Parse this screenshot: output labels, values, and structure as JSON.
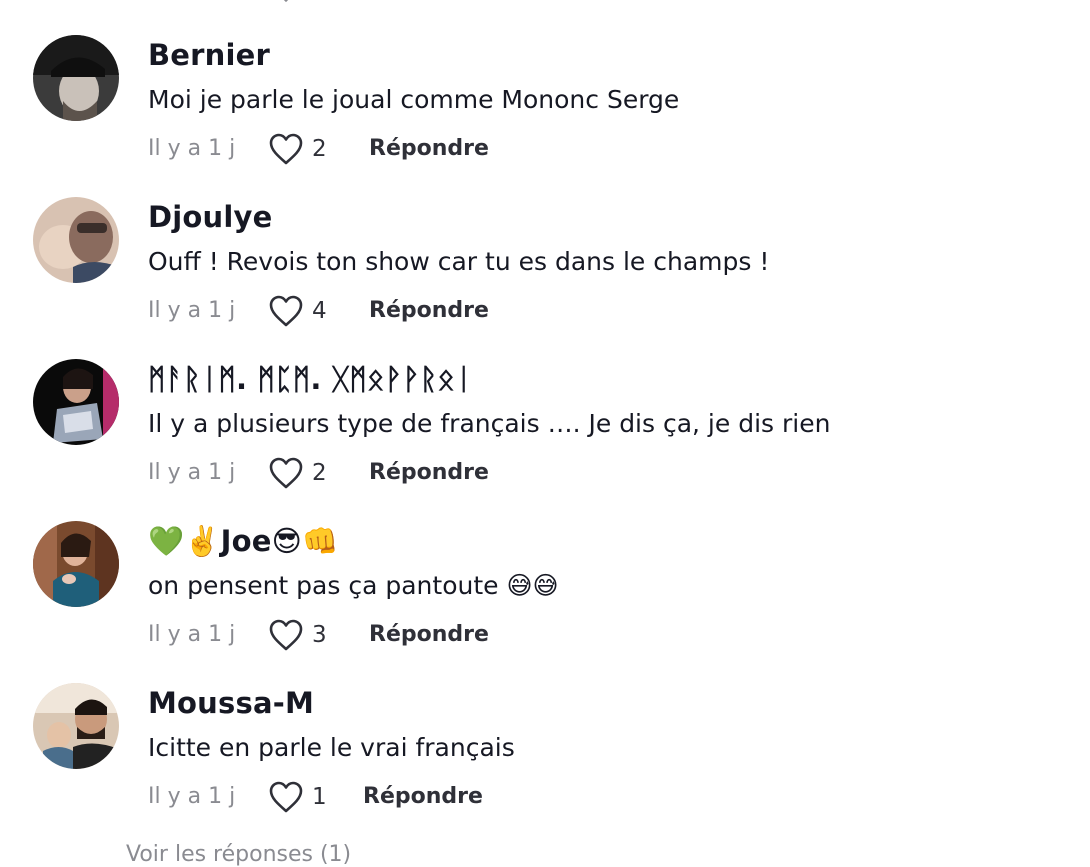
{
  "comments": [
    {
      "username": "Bernier",
      "text": "Moi je parle le joual comme Mononc Serge",
      "time": "Il y a 1 j",
      "likes": "2",
      "reply_label": "Répondre",
      "avatar_icon": "user-avatar-photo"
    },
    {
      "username": "Djoulye",
      "text": "Ouff ! Revois ton show car tu es dans le champs !",
      "time": "Il y a 1 j",
      "likes": "4",
      "reply_label": "Répondre",
      "avatar_icon": "user-avatar-photo"
    },
    {
      "username": "ᛗᚨᚱᛁᛗ. ᛗᛈᛗ. ᚷᛗᛟᚹᚹᚱᛟᛁ",
      "text": "Il y a plusieurs type de français …. Je dis ça, je dis rien",
      "time": "Il y a 1 j",
      "likes": "2",
      "reply_label": "Répondre",
      "avatar_icon": "user-avatar-photo"
    },
    {
      "username": "💚✌️Joe😎👊",
      "text": "on pensent pas ça pantoute 😅😅",
      "time": "Il y a 1 j",
      "likes": "3",
      "reply_label": "Répondre",
      "avatar_icon": "user-avatar-photo"
    },
    {
      "username": "Moussa-M",
      "text": "Icitte en parle le vrai français",
      "time": "Il y a 1 j",
      "likes": "1",
      "reply_label": "Répondre",
      "avatar_icon": "user-avatar-photo"
    }
  ],
  "footer": {
    "view_more": "Voir les réponses (1)"
  },
  "colors": {
    "text_primary": "#161823",
    "text_secondary": "#8a8b91",
    "heart_outline": "#2f3038"
  }
}
